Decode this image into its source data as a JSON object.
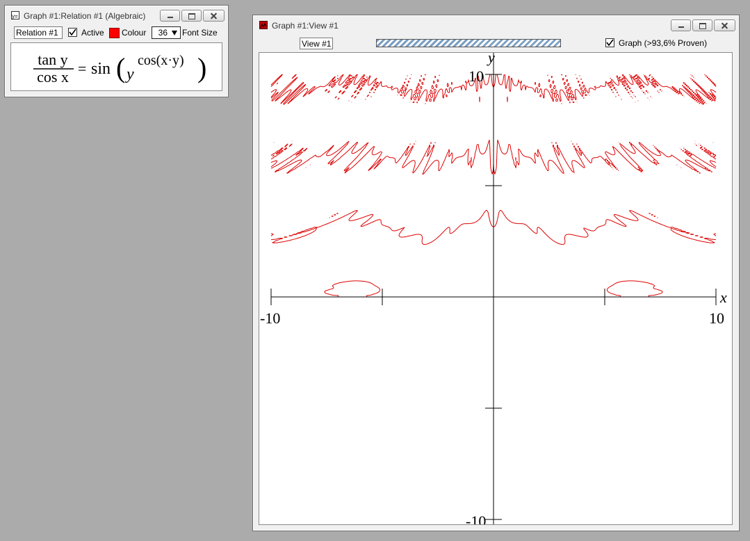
{
  "relation_window": {
    "title": "Graph #1:Relation #1 (Algebraic)",
    "icon": "relation-app-icon",
    "name_field": "Relation #1",
    "active_label": "Active",
    "active_checked": true,
    "colour_label": "Colour",
    "colour": "#ff0000",
    "font_size_value": "36",
    "font_size_label": "Font Size",
    "equation": {
      "numerator": "tan y",
      "denominator": "cos x",
      "equals": "=",
      "func": "sin",
      "base": "y",
      "exponent": "cos(x·y)"
    }
  },
  "view_window": {
    "title": "Graph #1:View #1",
    "icon": "graph-app-icon",
    "view_field": "View #1",
    "graph_checked": true,
    "graph_label": "Graph (>93,6% Proven)"
  },
  "chart_data": {
    "type": "scatter",
    "description_relation": "tan y / cos x = sin(y^cos(x·y))",
    "xlabel": "x",
    "ylabel": "y",
    "xlim": [
      -10,
      10
    ],
    "ylim": [
      -10,
      10
    ],
    "tick_labels": {
      "x_min": "-10",
      "x_max": "10",
      "y_max": "10",
      "y_min": "-10"
    },
    "series_color": "#dd0000",
    "grid": false
  }
}
